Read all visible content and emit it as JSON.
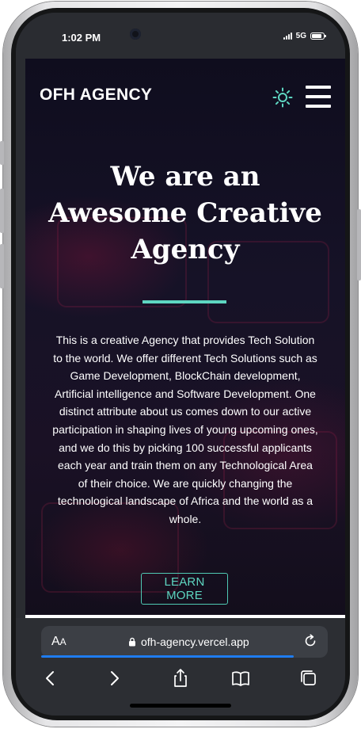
{
  "status_bar": {
    "time": "1:02 PM",
    "network": "5G"
  },
  "header": {
    "brand": "OFH AGENCY"
  },
  "hero": {
    "title": "We are an Awesome Creative Agency",
    "description": "This is a creative Agency that provides Tech Solution to the world. We offer different Tech Solutions such as Game Development, BlockChain development, Artificial intelligence and Software Development. One distinct attribute about us comes down to our active participation in shaping lives of young upcoming ones, and we do this by picking 100 successful applicants each year and train them on any Technological Area of their choice. We are quickly changing the technological landscape of Africa and the world as a whole.",
    "cta_label": "LEARN MORE"
  },
  "browser": {
    "aa_label": "AA",
    "url": "ofh-agency.vercel.app",
    "load_progress": 0.88
  },
  "icons": {
    "theme": "sun-icon",
    "menu": "hamburger-menu-icon",
    "lock": "lock-icon",
    "reload": "reload-icon",
    "back": "chevron-left-icon",
    "forward": "chevron-right-icon",
    "share": "share-icon",
    "bookmarks": "book-icon",
    "tabs": "tabs-icon"
  },
  "colors": {
    "accent": "#5ed6c1",
    "background": "#120f21",
    "browser_chrome": "#2c2e33",
    "progress": "#1f7cf0"
  }
}
